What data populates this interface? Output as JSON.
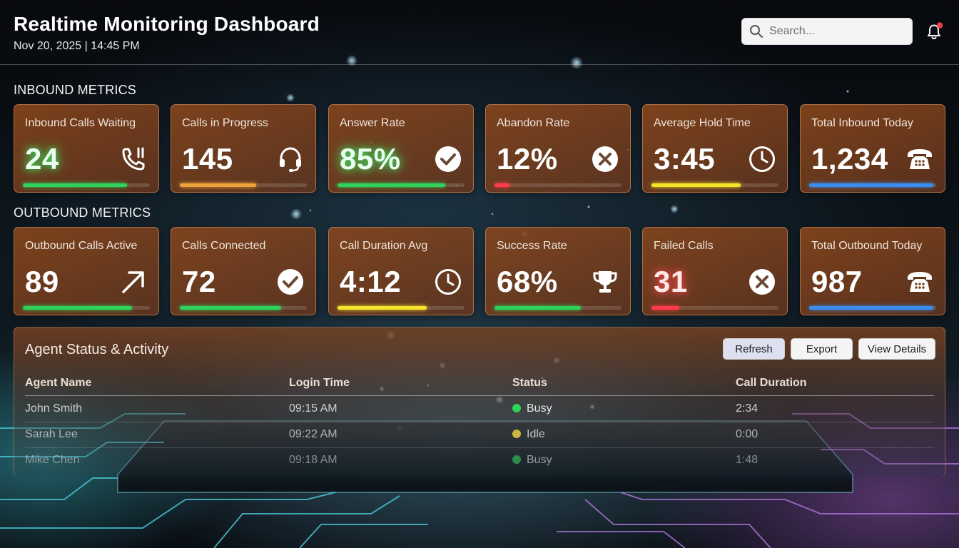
{
  "header": {
    "title": "Realtime Monitoring Dashboard",
    "datetime": "Nov 20, 2025 | 14:45 PM",
    "search_placeholder": "Search...",
    "notification_dot_color": "#e8434a"
  },
  "inbound": {
    "section_label": "INBOUND METRICS",
    "cards": [
      {
        "label": "Inbound Calls Waiting",
        "value": "24",
        "icon": "phone-waiting-icon",
        "bar_color": "#2fd35c",
        "fill": 0.82
      },
      {
        "label": "Calls in Progress",
        "value": "145",
        "icon": "headset-icon",
        "bar_color": "#f0a23a",
        "fill": 0.6
      },
      {
        "label": "Answer Rate",
        "value": "85%",
        "icon": "check-circle-icon",
        "bar_color": "#2fd35c",
        "fill": 0.85
      },
      {
        "label": "Abandon Rate",
        "value": "12%",
        "icon": "x-circle-icon",
        "bar_color": "#ff3b4d",
        "fill": 0.12
      },
      {
        "label": "Average Hold Time",
        "value": "3:45",
        "icon": "clock-icon",
        "bar_color": "#f6e42c",
        "fill": 0.7
      },
      {
        "label": "Total Inbound Today",
        "value": "1,234",
        "icon": "telephone-icon",
        "bar_color": "#3a8ef0",
        "fill": 0.98
      }
    ]
  },
  "outbound": {
    "section_label": "OUTBOUND METRICS",
    "cards": [
      {
        "label": "Outbound Calls Active",
        "value": "89",
        "icon": "arrow-up-right-icon",
        "bar_color": "#2fd35c",
        "fill": 0.86
      },
      {
        "label": "Calls Connected",
        "value": "72",
        "icon": "check-circle-icon",
        "bar_color": "#2fd35c",
        "fill": 0.8
      },
      {
        "label": "Call Duration Avg",
        "value": "4:12",
        "icon": "clock-icon",
        "bar_color": "#f6e42c",
        "fill": 0.7
      },
      {
        "label": "Success Rate",
        "value": "68%",
        "icon": "trophy-icon",
        "bar_color": "#2fd35c",
        "fill": 0.68
      },
      {
        "label": "Failed Calls",
        "value": "31",
        "icon": "x-circle-icon",
        "bar_color": "#ff3b4d",
        "fill": 0.22
      },
      {
        "label": "Total Outbound Today",
        "value": "987",
        "icon": "telephone-icon",
        "bar_color": "#3a8ef0",
        "fill": 0.98
      }
    ]
  },
  "agents": {
    "title": "Agent Status & Activity",
    "buttons": {
      "refresh": "Refresh",
      "export": "Export",
      "view_details": "View Details"
    },
    "columns": [
      "Agent Name",
      "Login Time",
      "Status",
      "Call Duration"
    ],
    "rows": [
      {
        "name": "John Smith",
        "login": "09:15 AM",
        "status": "Busy",
        "status_color": "#2fd35c",
        "duration": "2:34"
      },
      {
        "name": "Sarah Lee",
        "login": "09:22 AM",
        "status": "Idle",
        "status_color": "#f0d24a",
        "duration": "0:00"
      },
      {
        "name": "Mike Chen",
        "login": "09:18 AM",
        "status": "Busy",
        "status_color": "#2fd35c",
        "duration": "1:48"
      }
    ]
  }
}
